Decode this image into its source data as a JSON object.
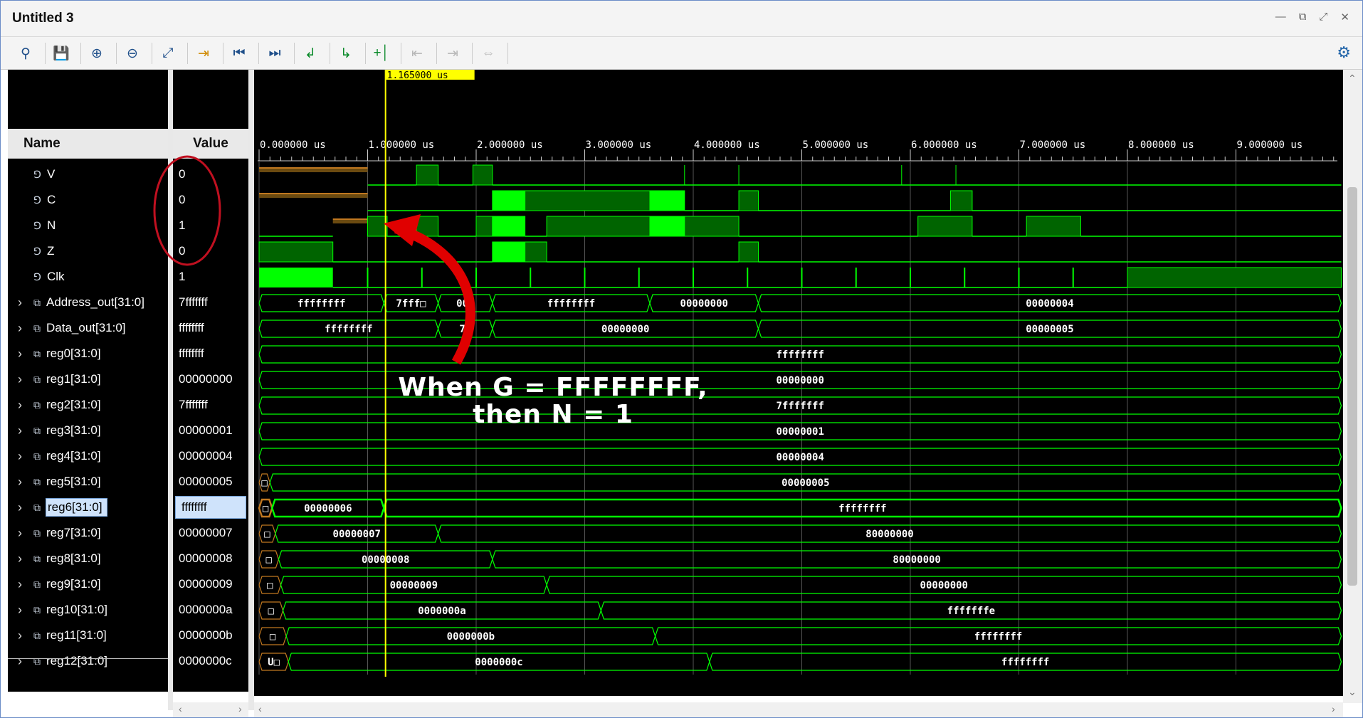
{
  "window": {
    "title": "Untitled 3"
  },
  "toolbar": {
    "icons": [
      "search-icon",
      "save-icon",
      "zoom-in-icon",
      "zoom-out-icon",
      "zoom-fit-icon",
      "go-to-cursor-icon",
      "go-to-start-icon",
      "go-to-end-icon",
      "previous-transition-icon",
      "next-transition-icon",
      "add-marker-icon",
      "previous-marker-icon",
      "next-marker-icon",
      "swap-cursors-icon",
      "settings-icon"
    ]
  },
  "columns": {
    "name": "Name",
    "value": "Value"
  },
  "cursor": {
    "label": "1.165000 us",
    "time_us": 1.165
  },
  "time_axis": {
    "ticks": [
      "0.000000 us",
      "1.000000 us",
      "2.000000 us",
      "3.000000 us",
      "4.000000 us",
      "5.000000 us",
      "6.000000 us",
      "7.000000 us",
      "8.000000 us",
      "9.000000 us"
    ]
  },
  "signals": [
    {
      "name": "V",
      "value": "0",
      "type": "bit"
    },
    {
      "name": "C",
      "value": "0",
      "type": "bit"
    },
    {
      "name": "N",
      "value": "1",
      "type": "bit"
    },
    {
      "name": "Z",
      "value": "0",
      "type": "bit"
    },
    {
      "name": "Clk",
      "value": "1",
      "type": "bit"
    },
    {
      "name": "Address_out[31:0]",
      "value": "7fffffff",
      "type": "bus"
    },
    {
      "name": "Data_out[31:0]",
      "value": "ffffffff",
      "type": "bus"
    },
    {
      "name": "reg0[31:0]",
      "value": "ffffffff",
      "type": "bus"
    },
    {
      "name": "reg1[31:0]",
      "value": "00000000",
      "type": "bus"
    },
    {
      "name": "reg2[31:0]",
      "value": "7fffffff",
      "type": "bus"
    },
    {
      "name": "reg3[31:0]",
      "value": "00000001",
      "type": "bus"
    },
    {
      "name": "reg4[31:0]",
      "value": "00000004",
      "type": "bus"
    },
    {
      "name": "reg5[31:0]",
      "value": "00000005",
      "type": "bus"
    },
    {
      "name": "reg6[31:0]",
      "value": "ffffffff",
      "type": "bus",
      "selected": true
    },
    {
      "name": "reg7[31:0]",
      "value": "00000007",
      "type": "bus"
    },
    {
      "name": "reg8[31:0]",
      "value": "00000008",
      "type": "bus"
    },
    {
      "name": "reg9[31:0]",
      "value": "00000009",
      "type": "bus"
    },
    {
      "name": "reg10[31:0]",
      "value": "0000000a",
      "type": "bus"
    },
    {
      "name": "reg11[31:0]",
      "value": "0000000b",
      "type": "bus"
    },
    {
      "name": "reg12[31:0]",
      "value": "0000000c",
      "type": "bus"
    }
  ],
  "bus_waves": {
    "Address_out[31:0]": [
      "ffffffff",
      "7fff□",
      "00□",
      "ffffffff",
      "00000000",
      "00000004"
    ],
    "Data_out[31:0]": [
      "ffffffff",
      "7f",
      "00000000",
      "00000005"
    ],
    "reg0[31:0]": [
      "ffffffff"
    ],
    "reg1[31:0]": [
      "00000000"
    ],
    "reg2[31:0]": [
      "7fffffff"
    ],
    "reg3[31:0]": [
      "00000001"
    ],
    "reg4[31:0]": [
      "00000004"
    ],
    "reg5[31:0]": [
      "□",
      "00000005"
    ],
    "reg6[31:0]": [
      "□",
      "00000006",
      "ffffffff"
    ],
    "reg7[31:0]": [
      "□",
      "00000007",
      "80000000"
    ],
    "reg8[31:0]": [
      "□",
      "00000008",
      "80000000"
    ],
    "reg9[31:0]": [
      "□",
      "00000009",
      "00000000"
    ],
    "reg10[31:0]": [
      "□",
      "0000000a",
      "fffffffe"
    ],
    "reg11[31:0]": [
      "□",
      "0000000b",
      "ffffffff"
    ],
    "reg12[31:0]": [
      "U□",
      "0000000c",
      "ffffffff"
    ]
  },
  "annotation": {
    "line1": "When G = FFFFFFFF,",
    "line2": "then N = 1"
  },
  "colors": {
    "wave_green": "#00ff00",
    "wave_dark_green": "#006400",
    "undefined_orange": "#c07820",
    "cursor_yellow": "#ffff00",
    "annotation_red": "#e00000"
  }
}
